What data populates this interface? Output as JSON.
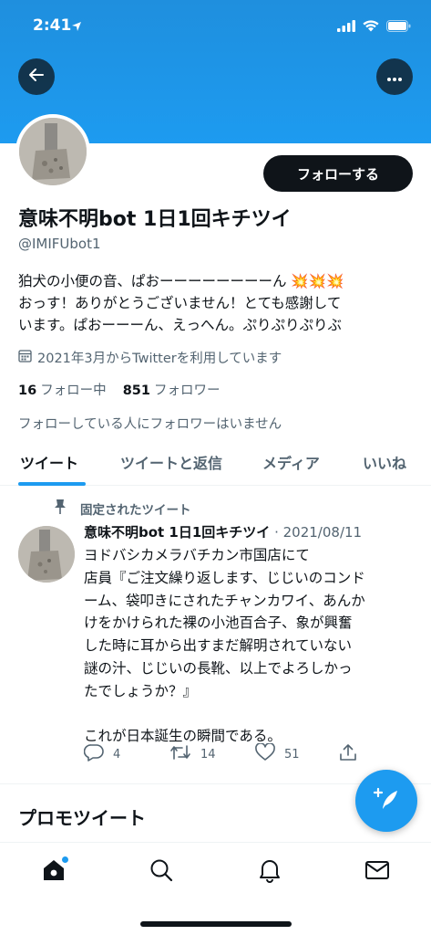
{
  "status_bar": {
    "time": "2:41"
  },
  "profile": {
    "display_name": "意味不明bot 1日1回キチツイ",
    "handle": "@IMIFUbot1",
    "follow_button": "フォローする",
    "bio_lines": [
      "狛犬の小便の音、ぱおーーーーーーーーん 💥💥💥",
      "おっす！ありがとうございません！とても感謝して",
      "います。ぱおーーーん、えっへん。ぷりぷりぷりぶ"
    ],
    "joined": "2021年3月からTwitterを利用しています",
    "following_count": "16",
    "following_label": "フォロー中",
    "followers_count": "851",
    "followers_label": "フォロワー",
    "no_followers_note": "フォローしている人にフォロワーはいません"
  },
  "tabs": [
    {
      "label": "ツイート",
      "active": true
    },
    {
      "label": "ツイートと返信",
      "active": false
    },
    {
      "label": "メディア",
      "active": false
    },
    {
      "label": "いいね",
      "active": false
    }
  ],
  "pinned_tweet": {
    "pinned_label": "固定されたツイート",
    "author": "意味不明bot 1日1回キチツイ",
    "date": "· 2021/08/11",
    "body_lines": [
      "ヨドバシカメラバチカン市国店にて",
      "店員『ご注文繰り返します、じじいのコンド",
      "ーム、袋叩きにされたチャンカワイ、あんか",
      "けをかけられた裸の小池百合子、象が興奮",
      "した時に耳から出すまだ解明されていない",
      "謎の汁、じじいの長靴、以上でよろしかっ",
      "たでしょうか？』",
      "",
      "これが日本誕生の瞬間である。"
    ],
    "replies": "4",
    "retweets": "14",
    "likes": "51"
  },
  "promo_heading": "プロモツイート",
  "colors": {
    "accent": "#1d9bf0",
    "text": "#0f1419",
    "secondary": "#536471"
  },
  "icons": {
    "back": "back-arrow-icon",
    "more": "more-icon",
    "calendar": "calendar-icon",
    "pin": "pin-icon",
    "reply": "reply-icon",
    "retweet": "retweet-icon",
    "like": "heart-icon",
    "share": "share-icon",
    "compose": "compose-icon",
    "home": "home-icon",
    "search": "search-icon",
    "notifications": "bell-icon",
    "messages": "mail-icon"
  }
}
